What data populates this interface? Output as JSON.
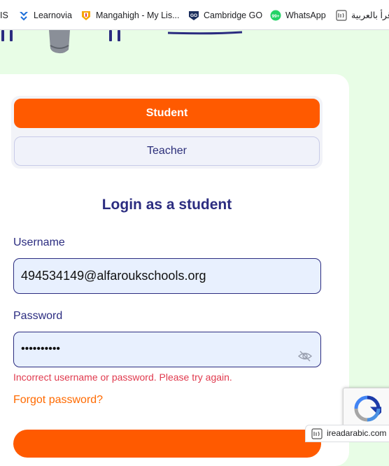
{
  "bookmarks": [
    {
      "label": "IS",
      "icon": "site-icon"
    },
    {
      "label": "Learnovia",
      "icon": "learnovia-icon"
    },
    {
      "label": "Mangahigh - My Lis...",
      "icon": "mangahigh-icon"
    },
    {
      "label": "Cambridge GO",
      "icon": "cambridge-go-icon"
    },
    {
      "label": "WhatsApp",
      "icon": "whatsapp-icon",
      "badge": "99+"
    },
    {
      "label": "أقرأ بالعربية",
      "icon": "iread-icon"
    }
  ],
  "login": {
    "role_student": "Student",
    "role_teacher": "Teacher",
    "heading": "Login as a student",
    "username_label": "Username",
    "username_value": "494534149@alfaroukschools.org",
    "password_label": "Password",
    "password_value": "••••••••••",
    "error": "Incorrect username or password. Please try again.",
    "forgot": "Forgot password?"
  },
  "status_url": "ireadarabic.com",
  "colors": {
    "accent": "#ff5a00",
    "navy": "#2b2c80",
    "error": "#e03a4e",
    "page_bg": "#e8fde6"
  }
}
